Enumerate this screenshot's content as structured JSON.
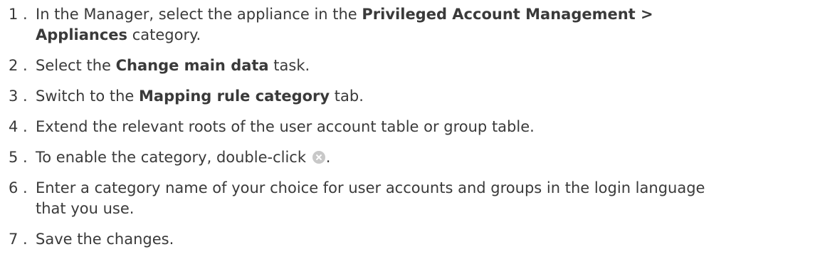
{
  "steps": [
    {
      "number": "1",
      "dot": ".",
      "text_a": "In the Manager, select the appliance in the ",
      "bold_a": "Privileged Account Management >",
      "text_b": " ",
      "bold_b": "Appliances",
      "text_c": " category."
    },
    {
      "number": "2",
      "dot": ".",
      "text_a": "Select the ",
      "bold_a": "Change main data",
      "text_b": " task."
    },
    {
      "number": "3",
      "dot": ".",
      "text_a": "Switch to the ",
      "bold_a": "Mapping rule category",
      "text_b": " tab."
    },
    {
      "number": "4",
      "dot": ".",
      "text_a": "Extend the relevant roots of the user account table or group table."
    },
    {
      "number": "5",
      "dot": ".",
      "text_a": "To enable the category, double-click ",
      "icon": "disabled-x-icon",
      "text_b": "."
    },
    {
      "number": "6",
      "dot": ".",
      "text_a": "Enter a category name of your choice for user accounts and groups in the login language that you use."
    },
    {
      "number": "7",
      "dot": ".",
      "text_a": "Save the changes."
    }
  ],
  "colors": {
    "text": "#3a3a3a",
    "icon": "#c8c8c8"
  }
}
